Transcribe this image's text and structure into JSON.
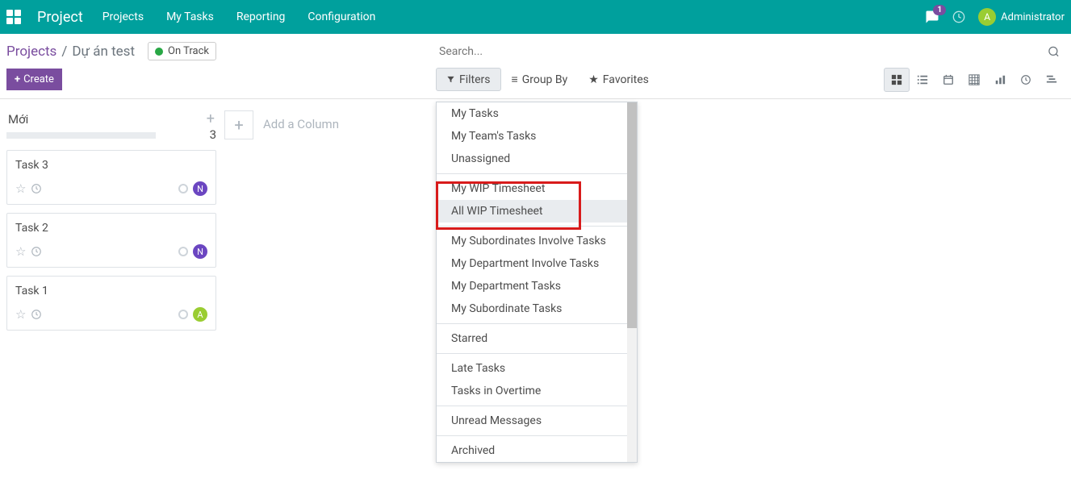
{
  "nav": {
    "brand": "Project",
    "menu": [
      "Projects",
      "My Tasks",
      "Reporting",
      "Configuration"
    ],
    "badge": "1",
    "user_initial": "A",
    "user_name": "Administrator"
  },
  "breadcrumb": {
    "parent": "Projects",
    "sep": "/",
    "current": "Dự án test"
  },
  "status": {
    "label": "On Track",
    "color": "#28a745"
  },
  "buttons": {
    "create": "Create"
  },
  "search": {
    "placeholder": "Search..."
  },
  "search_options": {
    "filters": "Filters",
    "groupby": "Group By",
    "favorites": "Favorites"
  },
  "kanban": {
    "column_title": "Mới",
    "column_count": "3",
    "add_column": "Add a Column",
    "cards": [
      {
        "title": "Task 3",
        "assignee_initial": "N",
        "assignee_color": "purple"
      },
      {
        "title": "Task 2",
        "assignee_initial": "N",
        "assignee_color": "purple"
      },
      {
        "title": "Task 1",
        "assignee_initial": "A",
        "assignee_color": "green"
      }
    ]
  },
  "filters_dropdown": {
    "groups": [
      [
        "My Tasks",
        "My Team's Tasks",
        "Unassigned"
      ],
      [
        "My WIP Timesheet",
        "All WIP Timesheet"
      ],
      [
        "My Subordinates Involve Tasks",
        "My Department Involve Tasks",
        "My Department Tasks",
        "My Subordinate Tasks"
      ],
      [
        "Starred"
      ],
      [
        "Late Tasks",
        "Tasks in Overtime"
      ],
      [
        "Unread Messages"
      ],
      [
        "Archived"
      ]
    ],
    "hovered": "All WIP Timesheet"
  }
}
